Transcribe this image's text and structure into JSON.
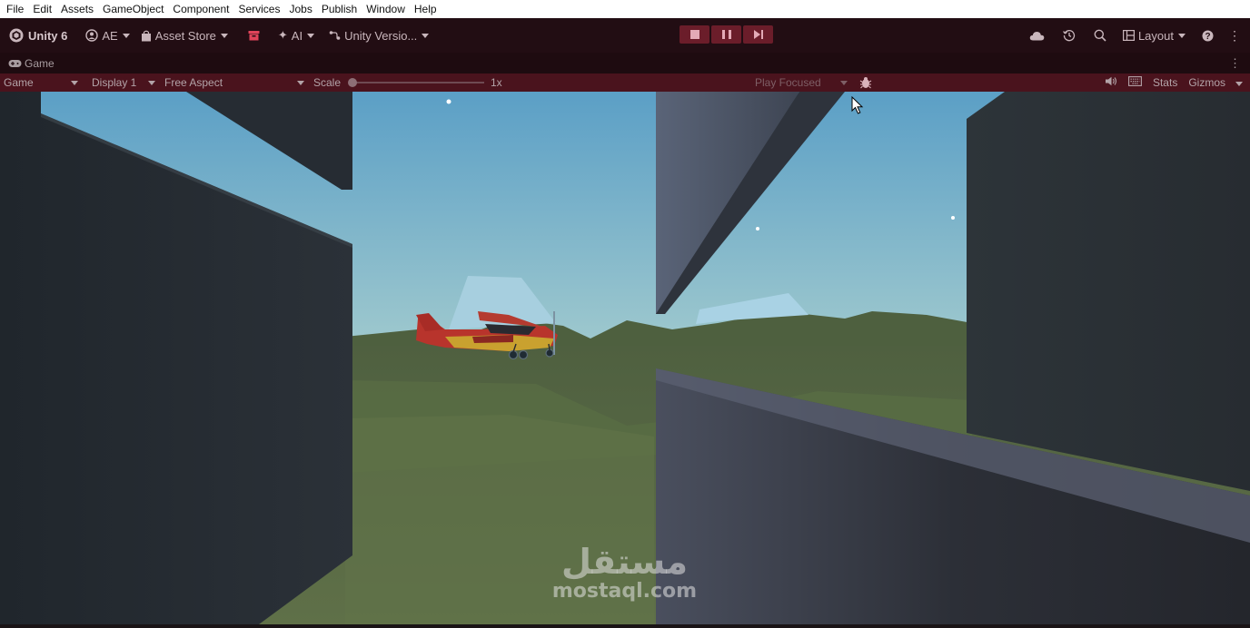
{
  "menu": [
    "File",
    "Edit",
    "Assets",
    "GameObject",
    "Component",
    "Services",
    "Jobs",
    "Publish",
    "Window",
    "Help"
  ],
  "toolbar": {
    "unity_label": "Unity 6",
    "account_label": "AE",
    "asset_store_label": "Asset Store",
    "ai_label": "AI",
    "version_control_label": "Unity Versio...",
    "layout_label": "Layout"
  },
  "tab": {
    "title": "Game"
  },
  "game_toolbar": {
    "view_mode": "Game",
    "display": "Display 1",
    "aspect": "Free Aspect",
    "scale_label": "Scale",
    "scale_value": "1x",
    "play_mode": "Play Focused",
    "stats_label": "Stats",
    "gizmos_label": "Gizmos"
  },
  "watermark": {
    "arabic": "مستقل",
    "latin": "mostaql.com"
  },
  "colors": {
    "menubar": "#ffffff",
    "toolbar": "#220d13",
    "game_toolbar": "#4a131d",
    "play_button": "#6b1d2a",
    "sky_top": "#5ea3c8",
    "ground": "#55683f",
    "plane_body": "#b8342c"
  }
}
